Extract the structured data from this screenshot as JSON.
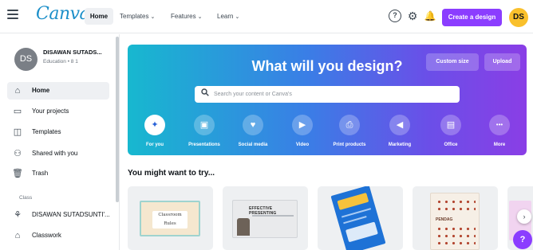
{
  "topbar": {
    "logo": "Canva",
    "home": "Home",
    "nav": [
      {
        "label": "Templates",
        "chevron": "⌄"
      },
      {
        "label": "Features",
        "chevron": "⌄"
      },
      {
        "label": "Learn",
        "chevron": "⌄"
      }
    ],
    "help_glyph": "?",
    "settings_glyph": "⚙",
    "bell_glyph": "🔔",
    "create_label": "Create a design",
    "avatar_initials": "DS",
    "accent": "#8b3dff"
  },
  "sidebar": {
    "account": {
      "initials": "DS",
      "name": "DISAWAN SUTADS...",
      "subtitle": "Education • 8 1"
    },
    "items": [
      {
        "label": "Home",
        "icon": "home-icon",
        "glyph": "⌂",
        "active": true
      },
      {
        "label": "Your projects",
        "icon": "folder-icon",
        "glyph": "▭",
        "active": false
      },
      {
        "label": "Templates",
        "icon": "templates-icon",
        "glyph": "◫",
        "active": false
      },
      {
        "label": "Shared with you",
        "icon": "shared-icon",
        "glyph": "⚇",
        "active": false
      },
      {
        "label": "Trash",
        "icon": "trash-icon",
        "glyph": "🗑",
        "active": false
      }
    ],
    "section_label": "Class",
    "class_items": [
      {
        "label": "DISAWAN SUTADSUNTI'...",
        "icon": "class-icon",
        "glyph": "⚘"
      },
      {
        "label": "Classwork",
        "icon": "classwork-icon",
        "glyph": "⌂"
      }
    ]
  },
  "hero": {
    "title": "What will you design?",
    "custom_size": "Custom size",
    "upload": "Upload",
    "search_placeholder": "Search your content or Canva's",
    "categories": [
      {
        "label": "For you",
        "icon": "sparkle-icon",
        "glyph": "✦",
        "active": true
      },
      {
        "label": "Presentations",
        "icon": "presentation-icon",
        "glyph": "▣",
        "active": false
      },
      {
        "label": "Social media",
        "icon": "heart-icon",
        "glyph": "♥",
        "active": false
      },
      {
        "label": "Video",
        "icon": "video-icon",
        "glyph": "▶",
        "active": false
      },
      {
        "label": "Print products",
        "icon": "printer-icon",
        "glyph": "⎙",
        "active": false
      },
      {
        "label": "Marketing",
        "icon": "megaphone-icon",
        "glyph": "◀",
        "active": false
      },
      {
        "label": "Office",
        "icon": "briefcase-icon",
        "glyph": "▤",
        "active": false
      },
      {
        "label": "More",
        "icon": "more-icon",
        "glyph": "•••",
        "active": false
      }
    ]
  },
  "suggestions": {
    "title": "You might want to try...",
    "cards": [
      {
        "name": "classroom-rules-card",
        "inner_text": "Classroom Rules"
      },
      {
        "name": "effective-presenting-card",
        "inner_text": "EFFECTIVE PRESENTING"
      },
      {
        "name": "infographic-card",
        "inner_text": ""
      },
      {
        "name": "document-card",
        "inner_text": "PENDAG"
      }
    ],
    "next_glyph": "›"
  },
  "help_fab": "?"
}
